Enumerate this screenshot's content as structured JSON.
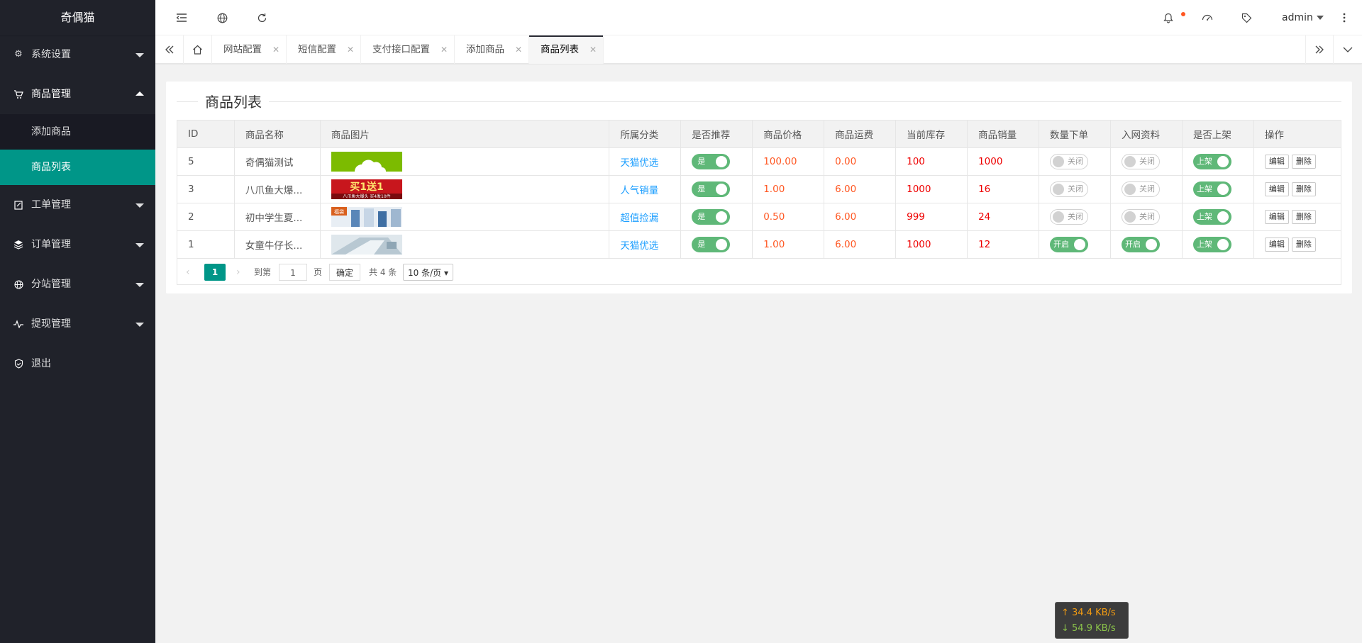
{
  "app": {
    "logo": "奇偶猫"
  },
  "sidebar": {
    "items": [
      {
        "label": "系统设置",
        "icon": "gear-icon"
      },
      {
        "label": "商品管理",
        "icon": "cart-icon"
      },
      {
        "label": "工单管理",
        "icon": "ticket-icon"
      },
      {
        "label": "订单管理",
        "icon": "layers-icon"
      },
      {
        "label": "分站管理",
        "icon": "globe-icon"
      },
      {
        "label": "提现管理",
        "icon": "pulse-icon"
      },
      {
        "label": "退出",
        "icon": "shield-icon"
      }
    ],
    "sub_items": [
      "添加商品",
      "商品列表"
    ]
  },
  "header": {
    "user": "admin"
  },
  "tabs": [
    {
      "label": "网站配置"
    },
    {
      "label": "短信配置"
    },
    {
      "label": "支付接口配置"
    },
    {
      "label": "添加商品"
    },
    {
      "label": "商品列表"
    }
  ],
  "page": {
    "title": "商品列表"
  },
  "table": {
    "headers": [
      "ID",
      "商品名称",
      "商品图片",
      "所属分类",
      "是否推荐",
      "商品价格",
      "商品运费",
      "当前库存",
      "商品销量",
      "数量下单",
      "入网资料",
      "是否上架",
      "操作"
    ],
    "rows": [
      {
        "id": "5",
        "name": "奇偶猫测试",
        "category": "天猫优选",
        "recommend": "是",
        "price": "100.00",
        "shipping": "0.00",
        "stock": "100",
        "sales": "1000",
        "qty_order": "关闭",
        "qty_on": false,
        "netinfo": "关闭",
        "net_on": false,
        "shelf": "上架"
      },
      {
        "id": "3",
        "name": "八爪鱼大爆...",
        "category": "人气销量",
        "recommend": "是",
        "price": "1.00",
        "shipping": "6.00",
        "stock": "1000",
        "sales": "16",
        "qty_order": "关闭",
        "qty_on": false,
        "netinfo": "关闭",
        "net_on": false,
        "shelf": "上架"
      },
      {
        "id": "2",
        "name": "初中学生夏...",
        "category": "超值捡漏",
        "recommend": "是",
        "price": "0.50",
        "shipping": "6.00",
        "stock": "999",
        "sales": "24",
        "qty_order": "关闭",
        "qty_on": false,
        "netinfo": "关闭",
        "net_on": false,
        "shelf": "上架"
      },
      {
        "id": "1",
        "name": "女童牛仔长...",
        "category": "天猫优选",
        "recommend": "是",
        "price": "1.00",
        "shipping": "6.00",
        "stock": "1000",
        "sales": "12",
        "qty_order": "开启",
        "qty_on": true,
        "netinfo": "开启",
        "net_on": true,
        "shelf": "上架"
      }
    ],
    "edit_label": "编辑",
    "delete_label": "删除",
    "thumb_text": {
      "row2": "买1送1",
      "row2_sub": "八爪鱼大爆头 买4发10件",
      "row3": "福袋"
    }
  },
  "pager": {
    "current": "1",
    "goto_label": "到第",
    "page_value": "1",
    "page_unit": "页",
    "confirm": "确定",
    "total": "共 4 条",
    "per_page": "10 条/页"
  },
  "netspeed": {
    "up": "34.4 KB/s",
    "down": "54.9 KB/s"
  },
  "colors": {
    "sidebar": "#20222a",
    "accent": "#009688",
    "switch_on": "#5fb878",
    "price": "#ff5722",
    "link": "#1e9fff"
  }
}
